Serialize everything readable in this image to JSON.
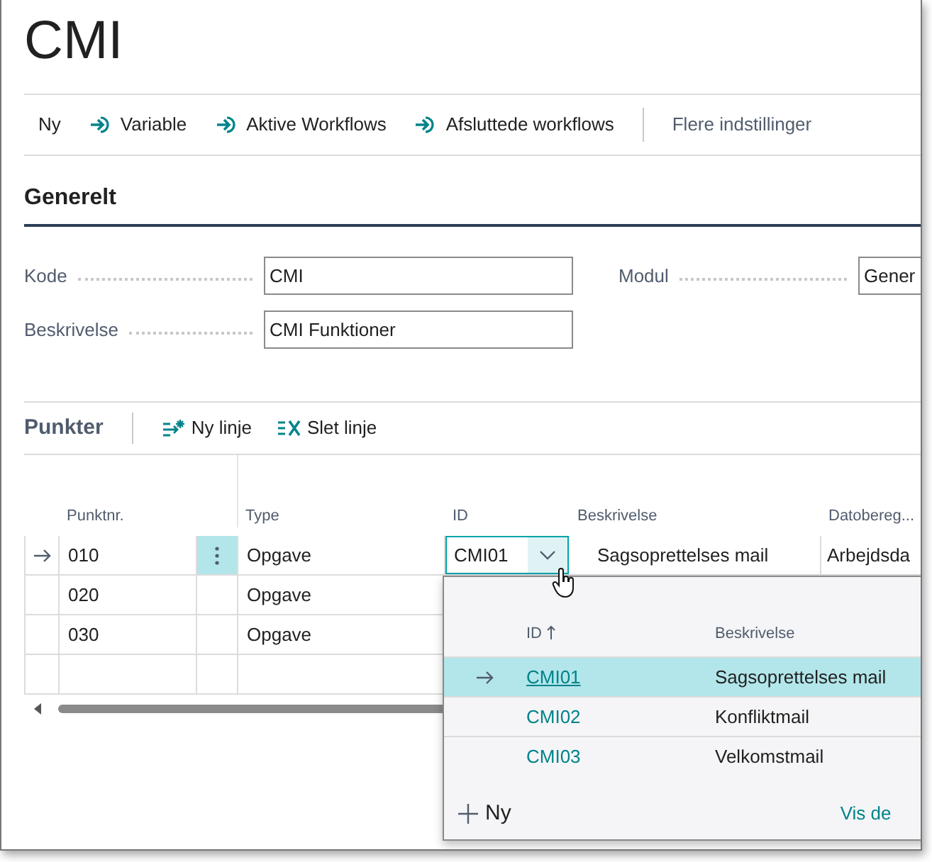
{
  "title": "CMI",
  "actions": [
    {
      "label": "Ny",
      "kind": "plain"
    },
    {
      "label": "Variable",
      "kind": "link"
    },
    {
      "label": "Aktive Workflows",
      "kind": "link"
    },
    {
      "label": "Afsluttede workflows",
      "kind": "link"
    },
    {
      "label": "Flere indstillinger",
      "kind": "more"
    }
  ],
  "general": {
    "heading": "Generelt",
    "fields": [
      {
        "label": "Kode",
        "value": "CMI"
      },
      {
        "label": "Modul",
        "value": "Gener"
      },
      {
        "label": "Beskrivelse",
        "value": "CMI Funktioner"
      }
    ]
  },
  "lines": {
    "heading": "Punkter",
    "actions": [
      {
        "label": "Ny linje",
        "kind": "new"
      },
      {
        "label": "Slet linje",
        "kind": "delete"
      }
    ],
    "columns": [
      "Punktnr.",
      "Type",
      "ID",
      "Beskrivelse",
      "Datobereg..."
    ],
    "rows": [
      {
        "punktnr": "010",
        "type": "Opgave",
        "id": "CMI01",
        "beskrivelse": "Sagsoprettelses mail",
        "datobereg": "Arbejdsda",
        "selected": true
      },
      {
        "punktnr": "020",
        "type": "Opgave",
        "selected": false
      },
      {
        "punktnr": "030",
        "type": "Opgave",
        "selected": false
      }
    ]
  },
  "lookup": {
    "columns": [
      "ID",
      "Beskrivelse"
    ],
    "rows": [
      {
        "id": "CMI01",
        "beskrivelse": "Sagsoprettelses mail",
        "selected": true
      },
      {
        "id": "CMI02",
        "beskrivelse": "Konfliktmail",
        "selected": false
      },
      {
        "id": "CMI03",
        "beskrivelse": "Velkomstmail",
        "selected": false
      }
    ],
    "new_label": "Ny",
    "more_label": "Vis de"
  }
}
